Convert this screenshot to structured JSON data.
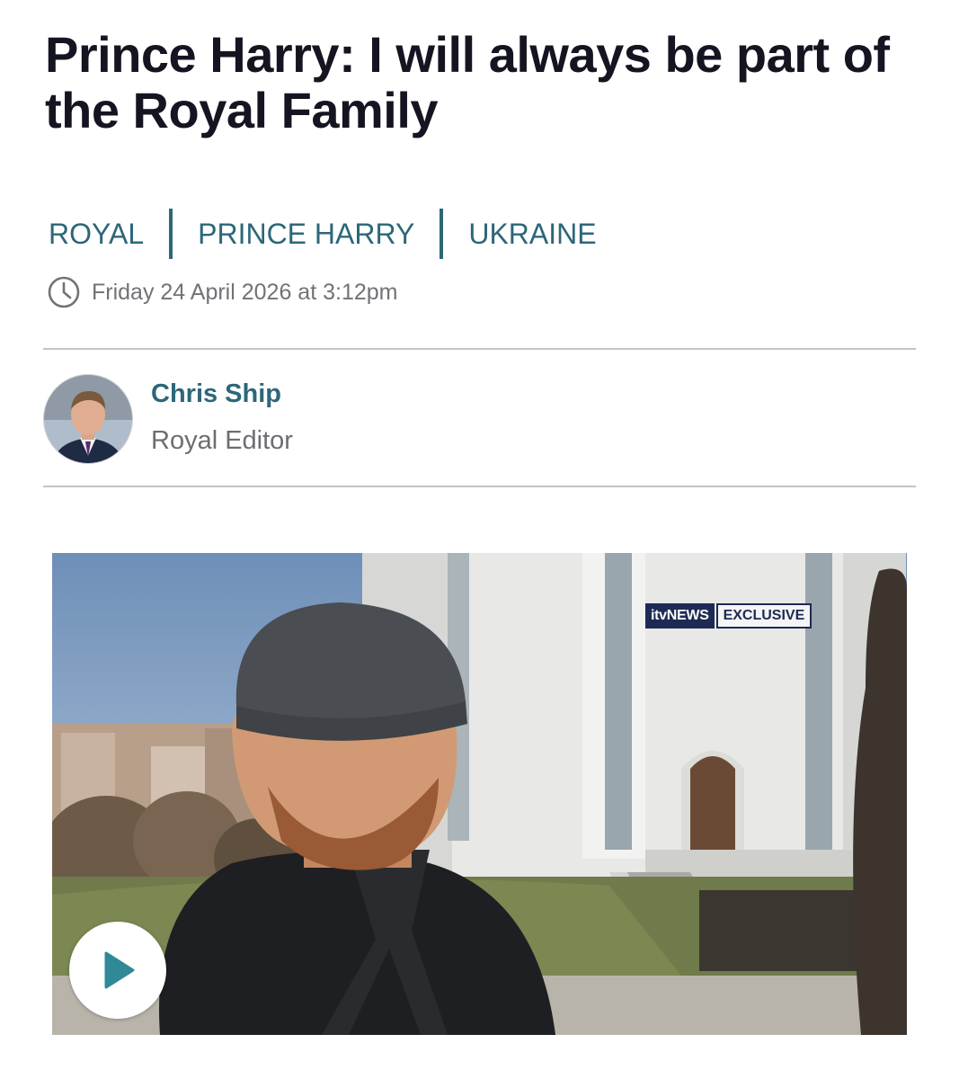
{
  "article": {
    "headline": "Prince Harry: I will always be part of the Royal Family",
    "tags": [
      "ROYAL",
      "PRINCE HARRY",
      "UKRAINE"
    ],
    "timestamp": "Friday 24 April 2026 at 3:12pm",
    "author": {
      "name": "Chris Ship",
      "role": "Royal Editor"
    }
  },
  "video": {
    "badge_brand": "itvNEWS",
    "badge_label": "EXCLUSIVE",
    "play_icon": "play-icon"
  },
  "colors": {
    "accent": "#2d6778",
    "headline": "#151522",
    "meta": "#727277",
    "divider": "#c4c4c6",
    "badge": "#1d2b54"
  }
}
